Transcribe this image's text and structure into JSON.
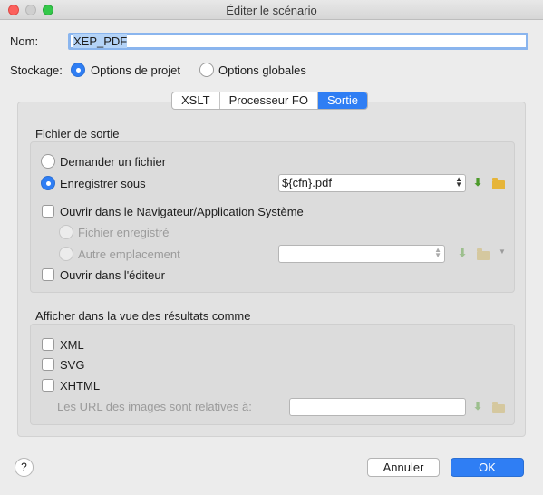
{
  "window": {
    "title": "Éditer le scénario"
  },
  "name": {
    "label": "Nom:",
    "value": "XEP_PDF"
  },
  "storage": {
    "label": "Stockage:",
    "options": [
      "Options de projet",
      "Options globales"
    ],
    "selected": "Options de projet"
  },
  "tabs": [
    {
      "label": "XSLT",
      "active": false
    },
    {
      "label": "Processeur FO",
      "active": false
    },
    {
      "label": "Sortie",
      "active": true
    }
  ],
  "output_file": {
    "heading": "Fichier de sortie",
    "ask_file_label": "Demander un fichier",
    "save_as_label": "Enregistrer sous",
    "save_as_value": "${cfn}.pdf",
    "open_browser_label": "Ouvrir dans le Navigateur/Application Système",
    "saved_file_label": "Fichier enregistré",
    "other_location_label": "Autre emplacement",
    "other_location_value": "",
    "open_editor_label": "Ouvrir dans l'éditeur"
  },
  "results_view": {
    "heading": "Afficher dans la vue des résultats comme",
    "xml_label": "XML",
    "svg_label": "SVG",
    "xhtml_label": "XHTML",
    "image_urls_label": "Les URL des images sont relatives à:",
    "image_urls_value": ""
  },
  "buttons": {
    "help": "?",
    "cancel": "Annuler",
    "ok": "OK"
  },
  "colors": {
    "accent": "#2f7ef4",
    "icon_download": "#4c9a2a",
    "icon_folder": "#e6b53a"
  }
}
